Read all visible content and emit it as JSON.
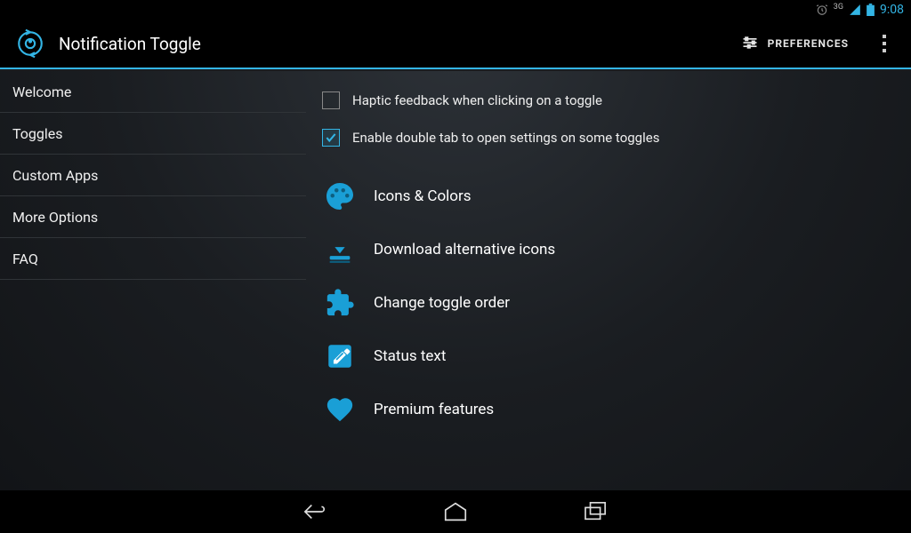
{
  "status": {
    "network_label": "3G",
    "time": "9:08"
  },
  "header": {
    "app_title": "Notification Toggle",
    "preferences_label": "PREFERENCES"
  },
  "sidebar": {
    "items": [
      {
        "label": "Welcome"
      },
      {
        "label": "Toggles"
      },
      {
        "label": "Custom Apps"
      },
      {
        "label": "More Options"
      },
      {
        "label": "FAQ"
      }
    ]
  },
  "main": {
    "checkboxes": [
      {
        "label": "Haptic feedback when clicking on a toggle",
        "checked": false
      },
      {
        "label": "Enable double tab to open settings on some toggles",
        "checked": true
      }
    ],
    "options": [
      {
        "label": "Icons & Colors",
        "icon": "palette-icon"
      },
      {
        "label": "Download alternative icons",
        "icon": "download-icon"
      },
      {
        "label": "Change toggle order",
        "icon": "puzzle-icon"
      },
      {
        "label": "Status text",
        "icon": "edit-note-icon"
      },
      {
        "label": "Premium features",
        "icon": "heart-icon"
      }
    ]
  },
  "colors": {
    "accent": "#33b5e5"
  }
}
